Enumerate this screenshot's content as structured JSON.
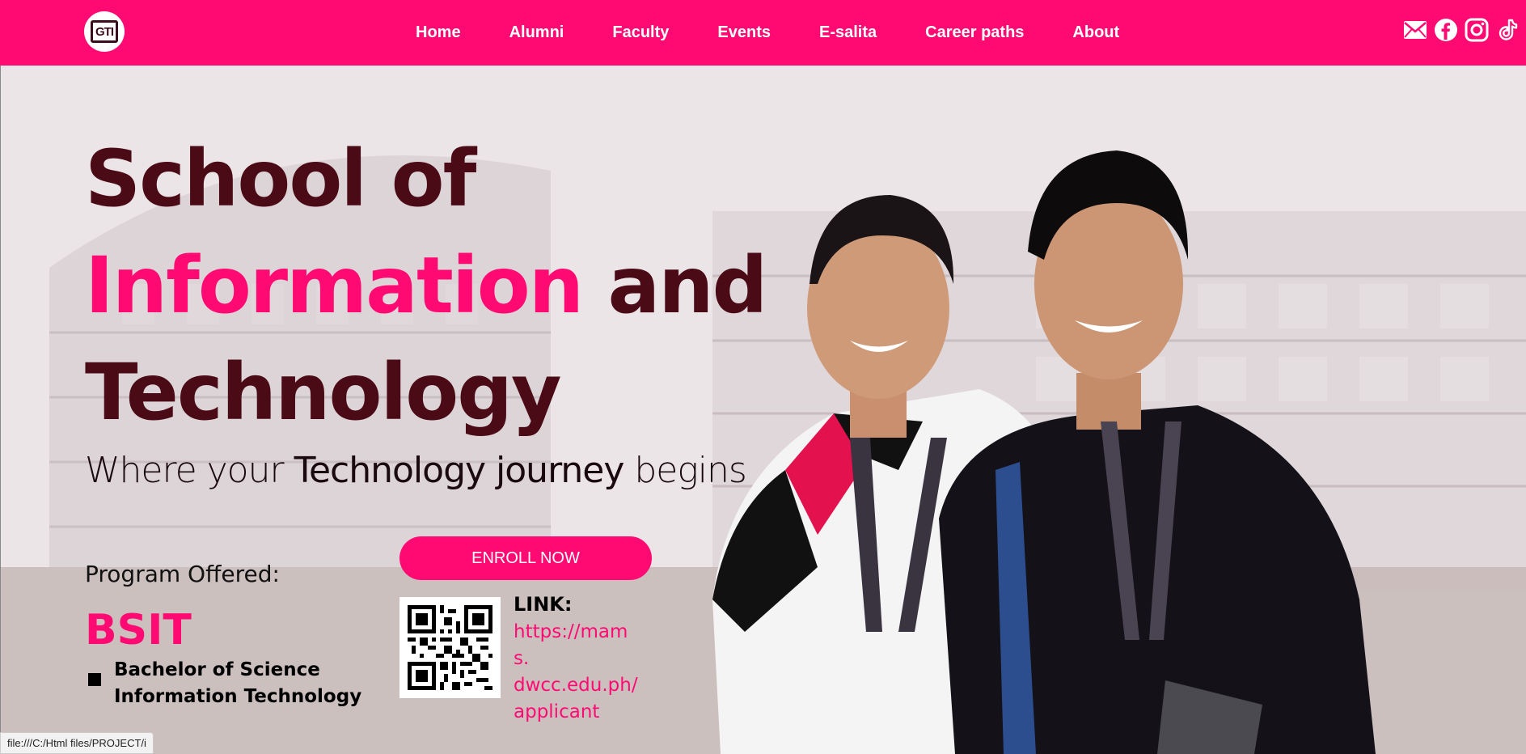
{
  "nav": {
    "logo_text": "GTI",
    "links": [
      "Home",
      "Alumni",
      "Faculty",
      "Events",
      "E-salita",
      "Career paths",
      "About"
    ],
    "social_icons": [
      "mail-icon",
      "facebook-icon",
      "instagram-icon",
      "tiktok-icon"
    ]
  },
  "hero": {
    "title_line1": "School of",
    "title_line2_pink": "Information",
    "title_line2_rest": " and",
    "title_line3": "Technology",
    "tagline_pre": "Where your ",
    "tagline_strong": "Technology journey",
    "tagline_post": " begins",
    "program_label": "Program Offered:",
    "program_code": "BSIT",
    "degree_line1": "Bachelor of Science",
    "degree_line2": "Information Technology",
    "enroll_label": "ENROLL NOW",
    "link_label": "LINK:",
    "link_url_line1": "https://mams.",
    "link_url_line2": "dwcc.edu.ph/",
    "link_url_line3": "applicant"
  },
  "status_bar": "file:///C:/Html files/PROJECT/i",
  "colors": {
    "brand_pink": "#ff0a73",
    "title_maroon": "#4a0a16"
  }
}
